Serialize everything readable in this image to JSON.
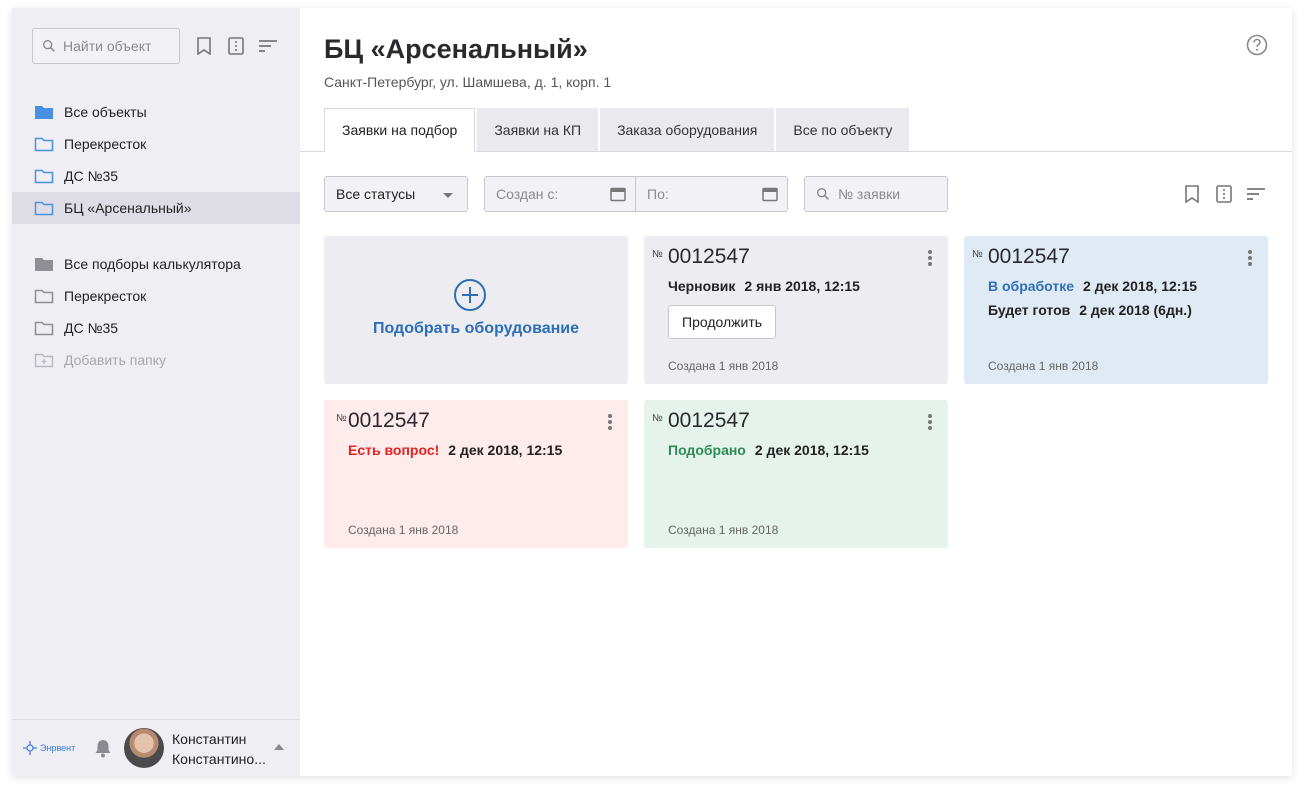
{
  "sidebar": {
    "search_placeholder": "Найти объект",
    "objects": [
      {
        "label": "Все объекты",
        "icon": "folder-filled-blue-icon"
      },
      {
        "label": "Перекресток",
        "icon": "folder-outline-icon"
      },
      {
        "label": "ДС №35",
        "icon": "folder-outline-icon"
      },
      {
        "label": "БЦ «Арсенальный»",
        "icon": "folder-outline-icon",
        "active": true
      }
    ],
    "calculator": [
      {
        "label": "Все подборы калькулятора",
        "icon": "folder-filled-gray-icon"
      },
      {
        "label": "Перекресток",
        "icon": "folder-outline-icon"
      },
      {
        "label": "ДС №35",
        "icon": "folder-outline-icon"
      }
    ],
    "add_folder": "Добавить папку",
    "brand": "Энрвент",
    "user": {
      "name_line1": "Константин",
      "name_line2": "Константино..."
    }
  },
  "header": {
    "title": "БЦ «Арсенальный»",
    "address": "Санкт-Петербург, ул. Шамшева, д. 1, корп. 1"
  },
  "tabs": [
    {
      "label": "Заявки на подбор",
      "active": true
    },
    {
      "label": "Заявки на КП"
    },
    {
      "label": "Заказа оборудования"
    },
    {
      "label": "Все по объекту"
    }
  ],
  "filters": {
    "status_value": "Все статусы",
    "created_from_placeholder": "Создан с:",
    "to_placeholder": "По:",
    "number_placeholder": "№ заявки"
  },
  "add_card": {
    "label": "Подобрать оборудование"
  },
  "cards": [
    {
      "num_sym": "№",
      "number": "0012547",
      "status": "Черновик",
      "status_color": "#222222",
      "date": "2 янв 2018, 12:15",
      "button": "Продолжить",
      "created": "Создана 1 янв 2018",
      "bg": "#ececf1"
    },
    {
      "num_sym": "№",
      "number": "0012547",
      "status": "В обработке",
      "status_color": "#2c6fb7",
      "date": "2 дек 2018, 12:15",
      "ready_label": "Будет готов",
      "ready_value": "2 дек 2018 (6дн.)",
      "created": "Создана 1 янв 2018",
      "bg": "#e0eaf5"
    },
    {
      "num_sym": "№",
      "number": "0012547",
      "status": "Есть вопрос!",
      "status_color": "#e02424",
      "date": "2 дек 2018, 12:15",
      "created": "Создана 1 янв 2018",
      "bg": "#fdeceb"
    },
    {
      "num_sym": "№",
      "number": "0012547",
      "status": "Подобрано",
      "status_color": "#2e8b57",
      "date": "2 дек 2018, 12:15",
      "created": "Создана 1 янв 2018",
      "bg": "#e5f3ec"
    }
  ],
  "colors": {
    "accent": "#2c6fb7",
    "folder_blue": "#4a90e2"
  }
}
